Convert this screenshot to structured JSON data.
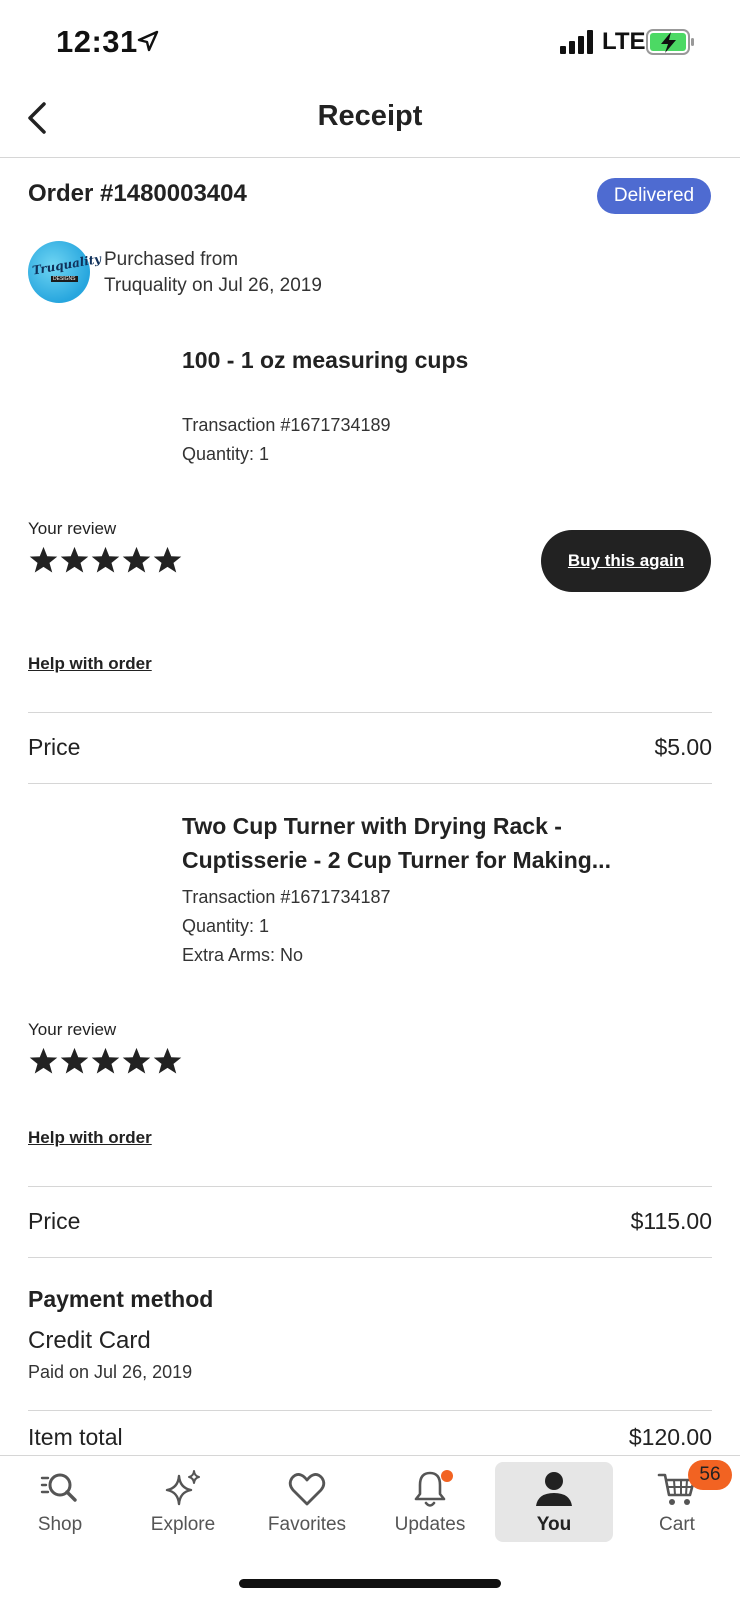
{
  "status_bar": {
    "time": "12:31",
    "network": "LTE"
  },
  "nav": {
    "title": "Receipt"
  },
  "order": {
    "title": "Order #1480003404",
    "status": "Delivered"
  },
  "shop": {
    "logo_text": "Truquality",
    "logo_sub": "DESIGNS",
    "purchased_line1": "Purchased from",
    "purchased_line2": "Truquality on Jul 26, 2019"
  },
  "items": [
    {
      "title": "100 - 1 oz measuring cups",
      "transaction": "Transaction #1671734189",
      "quantity": "Quantity: 1",
      "review_label": "Your review",
      "rating": 5,
      "buy_again_label": "Buy this again",
      "help_label": "Help with order",
      "price_label": "Price",
      "price": "$5.00"
    },
    {
      "title_line1": "Two Cup Turner with Drying Rack -",
      "title_line2": "Cuptisserie - 2 Cup Turner for Making...",
      "transaction": "Transaction #1671734187",
      "quantity": "Quantity: 1",
      "extra": "Extra Arms: No",
      "review_label": "Your review",
      "rating": 5,
      "help_label": "Help with order",
      "price_label": "Price",
      "price": "$115.00"
    }
  ],
  "payment": {
    "heading": "Payment method",
    "method": "Credit Card",
    "paid_on": "Paid on Jul 26, 2019"
  },
  "totals": {
    "item_total_label": "Item total",
    "item_total": "$120.00"
  },
  "tab_bar": {
    "tabs": [
      {
        "label": "Shop",
        "icon": "search-icon"
      },
      {
        "label": "Explore",
        "icon": "sparkle-icon"
      },
      {
        "label": "Favorites",
        "icon": "heart-icon"
      },
      {
        "label": "Updates",
        "icon": "bell-icon"
      },
      {
        "label": "You",
        "icon": "person-icon",
        "active": true
      },
      {
        "label": "Cart",
        "icon": "cart-icon",
        "badge": "56"
      }
    ]
  },
  "colors": {
    "badge_blue": "#4e6bd1",
    "accent_orange": "#f26322",
    "button_dark": "#222222"
  }
}
